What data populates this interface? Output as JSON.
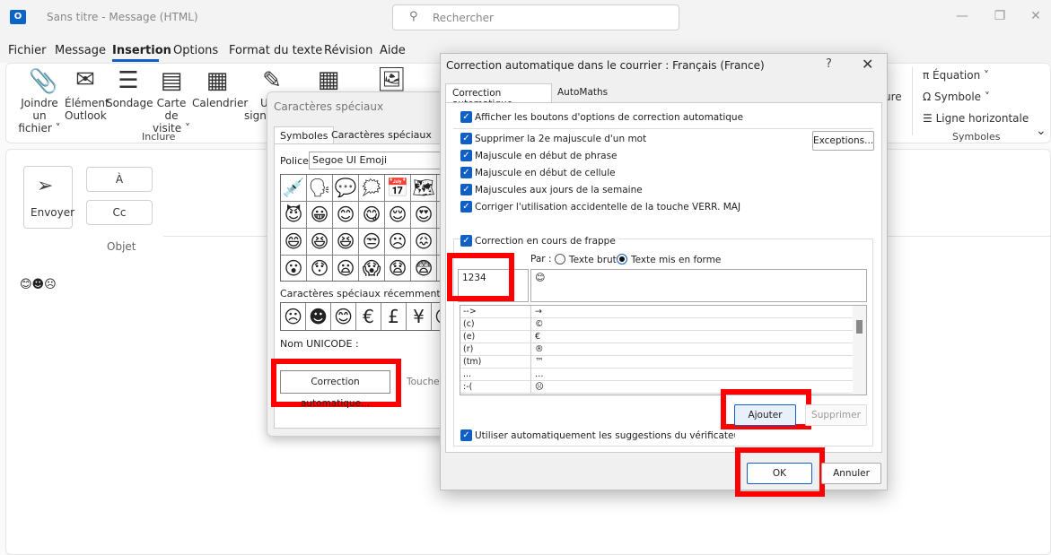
{
  "titlebar": {
    "app_logo": "O",
    "doc_title": "Sans titre  -  Message (HTML)",
    "search_placeholder": "Rechercher",
    "minimize": "—",
    "restore": "❐",
    "close": "✕"
  },
  "menu": {
    "fichier": "Fichier",
    "message": "Message",
    "insertion": "Insertion",
    "options": "Options",
    "format": "Format du texte",
    "revision": "Révision",
    "aide": "Aide"
  },
  "ribbon": {
    "attach": [
      "Joindre un",
      "fichier ˅"
    ],
    "outlook_item": [
      "Élément",
      "Outlook"
    ],
    "poll": "Sondage",
    "business_card": [
      "Carte de",
      "visite ˅"
    ],
    "calendar": "Calendrier",
    "signature": [
      "U",
      "signa"
    ],
    "group_inclure": "Inclure",
    "partial_label": "ure",
    "equation": "Équation  ˅",
    "symbole": "Symbole ˅",
    "ligne": "Ligne horizontale",
    "group_symboles": "Symboles",
    "expand": "⌄"
  },
  "compose": {
    "send_label": "Envoyer",
    "to_label": "À",
    "cc_label": "Cc",
    "objet_label": "Objet",
    "body_emojis": "😊☻☹"
  },
  "char_dialog": {
    "title": "Caractères spéciaux",
    "tab_symbols": "Symboles",
    "tab_special": "Caractères spéciaux",
    "police_label": "Police :",
    "police_value": "Segoe UI Emoji",
    "grid": [
      "💉",
      "🗣",
      "💬",
      "🗯",
      "📅",
      "🗺",
      "👤",
      "😈",
      "😀",
      "😊",
      "😋",
      "😌",
      "😍",
      "😎",
      "😄",
      "😆",
      "😆",
      "😒",
      "☹",
      "😖",
      "😡",
      "😮",
      "😯",
      "😦",
      "😱",
      "😧",
      "😨",
      "😮"
    ],
    "recent_label": "Caractères spéciaux récemment utilisés :",
    "recent": [
      "☹",
      "☻",
      "😊",
      "€",
      "£",
      "¥",
      "😮"
    ],
    "unicode_label": "Nom UNICODE :",
    "autocorr_button": "Correction automatique...",
    "shortcut_button": "Touche de raccourci..."
  },
  "main_dialog": {
    "title": "Correction automatique dans le courrier : Français (France)",
    "help": "?",
    "close": "✕",
    "tab_ac": "Correction automatique",
    "tab_am": "AutoMaths",
    "check": "✓",
    "opt_show_buttons": "Afficher les boutons d'options de correction automatique",
    "opt_second_cap": "Supprimer la 2e majuscule d'un mot",
    "opt_sentence_cap": "Majuscule en début de phrase",
    "opt_cell_cap": "Majuscule en début de cellule",
    "opt_days_cap": "Majuscules aux jours de la semaine",
    "opt_caps_lock": "Corriger l'utilisation accidentelle de la touche VERR. MAJ",
    "exceptions": "Exceptions...",
    "opt_while_typing": "Correction en cours de frappe",
    "par_label": "Par :",
    "radio_brut": "Texte brut",
    "radio_mis": "Texte mis en forme",
    "replace_value": "1234",
    "with_value": "😊",
    "table": [
      {
        "key": "-->",
        "val": "→"
      },
      {
        "key": "(c)",
        "val": "©"
      },
      {
        "key": "(e)",
        "val": "€"
      },
      {
        "key": "(r)",
        "val": "®"
      },
      {
        "key": "(tm)",
        "val": "™"
      },
      {
        "key": "...",
        "val": "…"
      },
      {
        "key": ":-(",
        "val": "☹"
      }
    ],
    "add_button": "Ajouter",
    "delete_button": "Supprimer",
    "opt_suggestions": "Utiliser automatiquement les suggestions du vérificateur d'orthographe",
    "ok_button": "OK",
    "cancel_button": "Annuler"
  }
}
